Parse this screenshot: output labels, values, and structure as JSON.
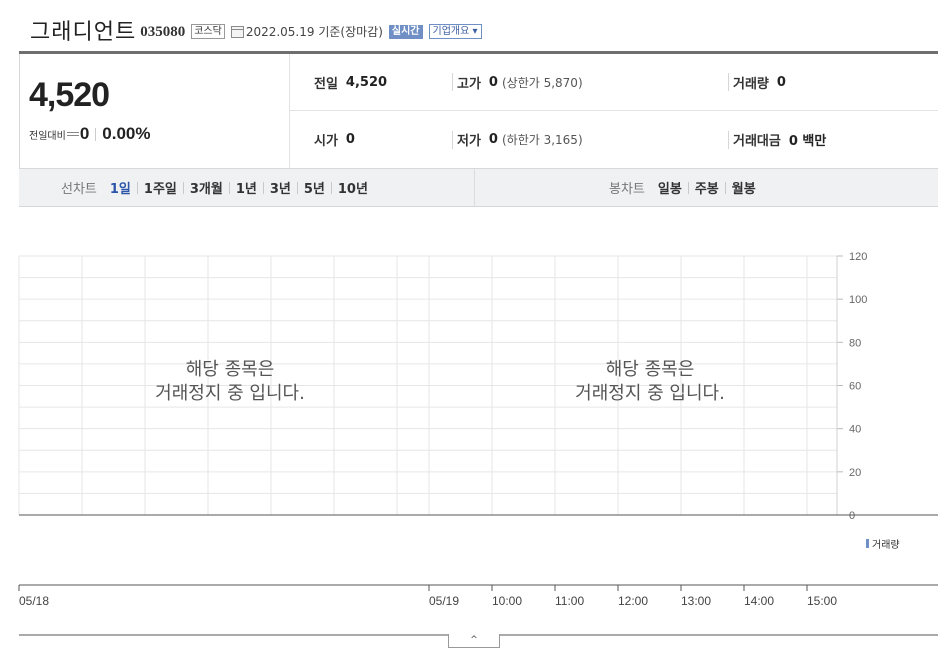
{
  "header": {
    "company_name": "그래디언트",
    "stock_code": "035080",
    "market": "코스닥",
    "date_basis": "2022.05.19 기준(장마감)",
    "realtime_label": "실시간",
    "overview_label": "기업개요",
    "overview_caret": "▾"
  },
  "summary": {
    "current_price": "4,520",
    "change_label": "전일대비",
    "change_value": "0",
    "change_pct": "0.00%",
    "prev_close_label": "전일",
    "prev_close": "4,520",
    "high_label": "고가",
    "high": "0",
    "upper_limit": "(상한가 5,870)",
    "volume_label": "거래량",
    "volume": "0",
    "open_label": "시가",
    "open": "0",
    "low_label": "저가",
    "low": "0",
    "lower_limit": "(하한가 3,165)",
    "amount_label": "거래대금",
    "amount": "0 백만"
  },
  "tabs": {
    "line_label": "선차트",
    "line_tabs": [
      "1일",
      "1주일",
      "3개월",
      "1년",
      "3년",
      "5년",
      "10년"
    ],
    "active_line_tab": "1일",
    "candle_label": "봉차트",
    "candle_tabs": [
      "일봉",
      "주봉",
      "월봉"
    ]
  },
  "chart": {
    "halt_message_line1": "해당 종목은",
    "halt_message_line2": "거래정지 중 입니다.",
    "legend_volume": "거래량",
    "collapse_label": "^"
  },
  "chart_data": {
    "type": "bar",
    "x": [
      "05/18",
      "05/19",
      "10:00",
      "11:00",
      "12:00",
      "13:00",
      "14:00",
      "15:00"
    ],
    "ylim": [
      0,
      120
    ],
    "yticks": [
      0,
      20,
      40,
      60,
      80,
      100,
      120
    ],
    "series": [
      {
        "name": "거래량",
        "values": []
      }
    ],
    "grid": true,
    "legend": "bottom-right",
    "colors": {
      "volume": "#6f8fc5",
      "grid": "#e6e6e6"
    }
  }
}
